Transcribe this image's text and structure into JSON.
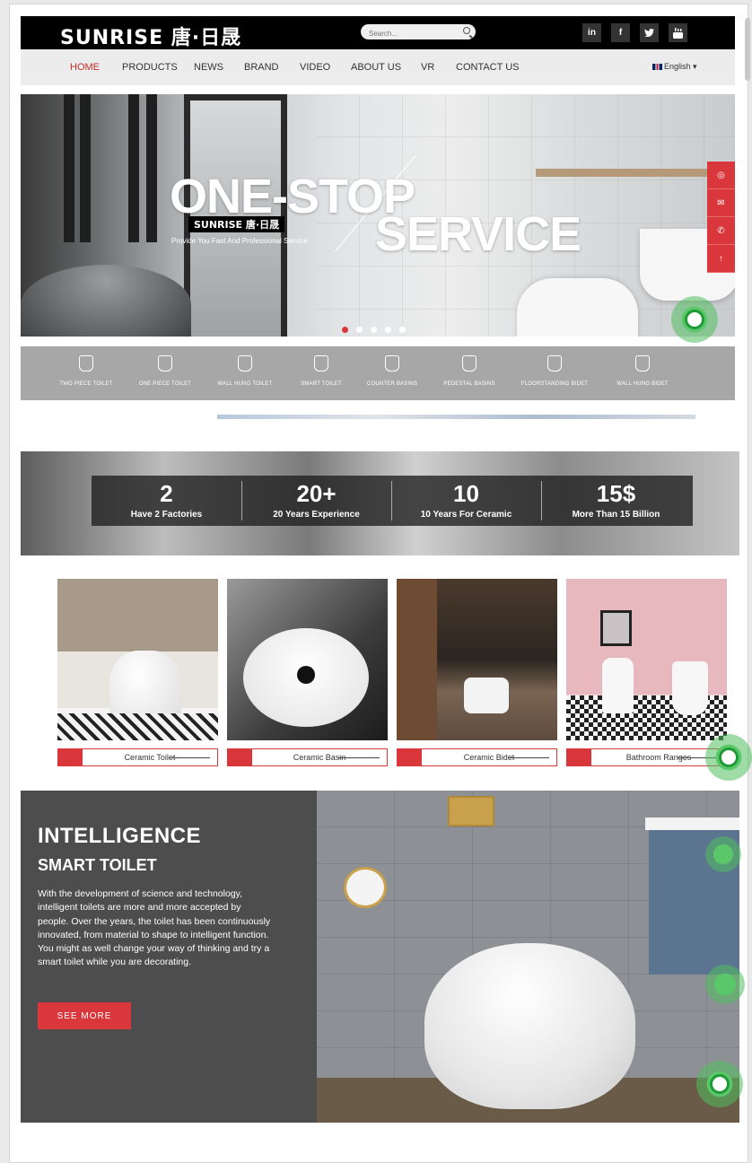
{
  "brand": {
    "logo": "SUNRISE 唐·日晟"
  },
  "search": {
    "placeholder": "Search..."
  },
  "social": [
    "in",
    "f",
    "t",
    "yt"
  ],
  "nav": {
    "items": [
      "HOME",
      "PRODUCTS",
      "NEWS",
      "BRAND",
      "VIDEO",
      "ABOUT US",
      "VR",
      "CONTACT US"
    ],
    "active": "HOME",
    "language": "English"
  },
  "hero": {
    "title_line1": "ONE-STOP",
    "title_line2": "SERVICE",
    "brand_tag": "SUNRISE 唐·日晟",
    "subtitle": "Provide You Fast And Professional Service.",
    "slide_count": 5,
    "active_slide": 1
  },
  "side_buttons": [
    "whatsapp-icon",
    "mail-icon",
    "phone-icon",
    "arrow-up-icon"
  ],
  "categories": [
    "TWO PIECE TOILET",
    "ONE PIECE TOILET",
    "WALL HUNG TOILET",
    "SMART TOILET",
    "COUNTER BASINS",
    "PEDESTAL BASINS",
    "FLOORSTANDING BIDET",
    "WALL HUNG BIDET"
  ],
  "stats": [
    {
      "value": "2",
      "label": "Have 2 Factories"
    },
    {
      "value": "20+",
      "label": "20 Years Experience"
    },
    {
      "value": "10",
      "label": "10 Years For Ceramic"
    },
    {
      "value": "15$",
      "label": "More Than 15 Billion"
    }
  ],
  "products": [
    "Ceramic Toilet",
    "Ceramic Basin",
    "Ceramic Bidet",
    "Bathroom Ranges"
  ],
  "intelligence": {
    "title": "INTELLIGENCE",
    "subtitle": "SMART TOILET",
    "description": "With the development of science and technology, intelligent toilets are more and more accepted by people. Over the years, the toilet has been continuously innovated, from material to shape to intelligent function. You might as well change your way of thinking and try a smart toilet while you are decorating.",
    "button": "SEE MORE"
  },
  "colors": {
    "accent": "#d9373c",
    "topbar": "#000000",
    "navbar": "#ececec",
    "category_bar": "#a7a7a7",
    "intel_panel": "#4d4d4d",
    "whatsapp": "#5ac76a"
  }
}
